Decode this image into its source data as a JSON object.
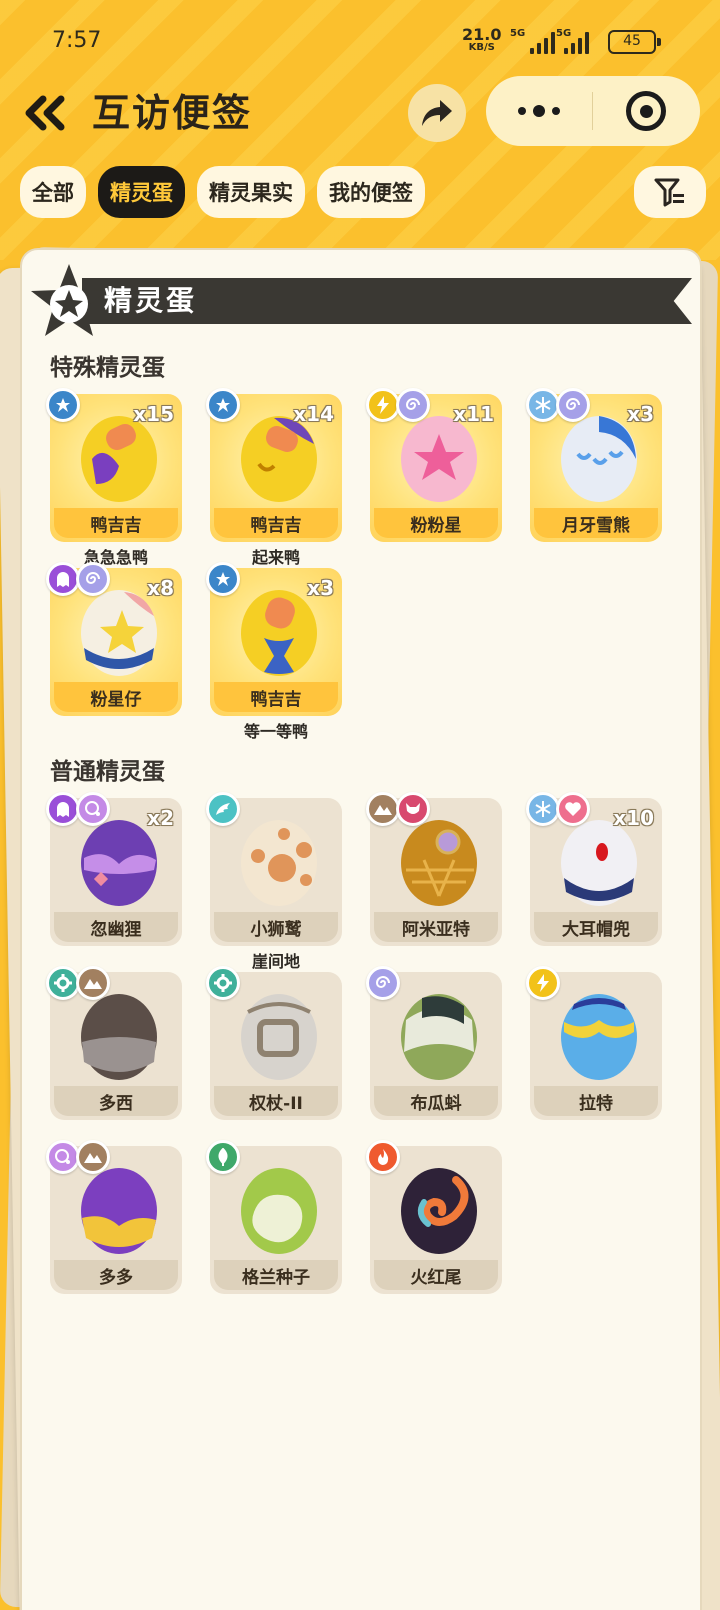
{
  "status": {
    "time": "7:57",
    "net_speed": "21.0",
    "net_unit": "KB/S",
    "sig1": "5G",
    "sig2": "5G",
    "battery": "45"
  },
  "header": {
    "title": "互访便签"
  },
  "tabs": [
    "全部",
    "精灵蛋",
    "精灵果实",
    "我的便签"
  ],
  "active_tab": 1,
  "panel": {
    "title": "精灵蛋"
  },
  "special": {
    "title": "特殊精灵蛋",
    "eggs": [
      {
        "name": "鸭吉吉",
        "sub": "急急急鸭",
        "count": "x15"
      },
      {
        "name": "鸭吉吉",
        "sub": "起来鸭",
        "count": "x14"
      },
      {
        "name": "粉粉星",
        "sub": "",
        "count": "x11"
      },
      {
        "name": "月牙雪熊",
        "sub": "",
        "count": "x3"
      },
      {
        "name": "粉星仔",
        "sub": "",
        "count": "x8"
      },
      {
        "name": "鸭吉吉",
        "sub": "等一等鸭",
        "count": "x3"
      }
    ]
  },
  "normal": {
    "title": "普通精灵蛋",
    "eggs": [
      {
        "name": "忽幽狸",
        "sub": "",
        "count": "x2"
      },
      {
        "name": "小狮鹫",
        "sub": "崖间地",
        "count": ""
      },
      {
        "name": "阿米亚特",
        "sub": "",
        "count": ""
      },
      {
        "name": "大耳帽兜",
        "sub": "",
        "count": "x10"
      },
      {
        "name": "多西",
        "sub": "",
        "count": ""
      },
      {
        "name": "权杖-II",
        "sub": "",
        "count": ""
      },
      {
        "name": "布瓜蚪",
        "sub": "",
        "count": ""
      },
      {
        "name": "拉特",
        "sub": "",
        "count": ""
      },
      {
        "name": "多多",
        "sub": "",
        "count": ""
      },
      {
        "name": "格兰种子",
        "sub": "",
        "count": ""
      },
      {
        "name": "火红尾",
        "sub": "",
        "count": ""
      }
    ]
  },
  "colors": {
    "accent": "#fbc02d",
    "tab_active_bg": "#1c1a17",
    "tab_active_text": "#ffc93a"
  }
}
